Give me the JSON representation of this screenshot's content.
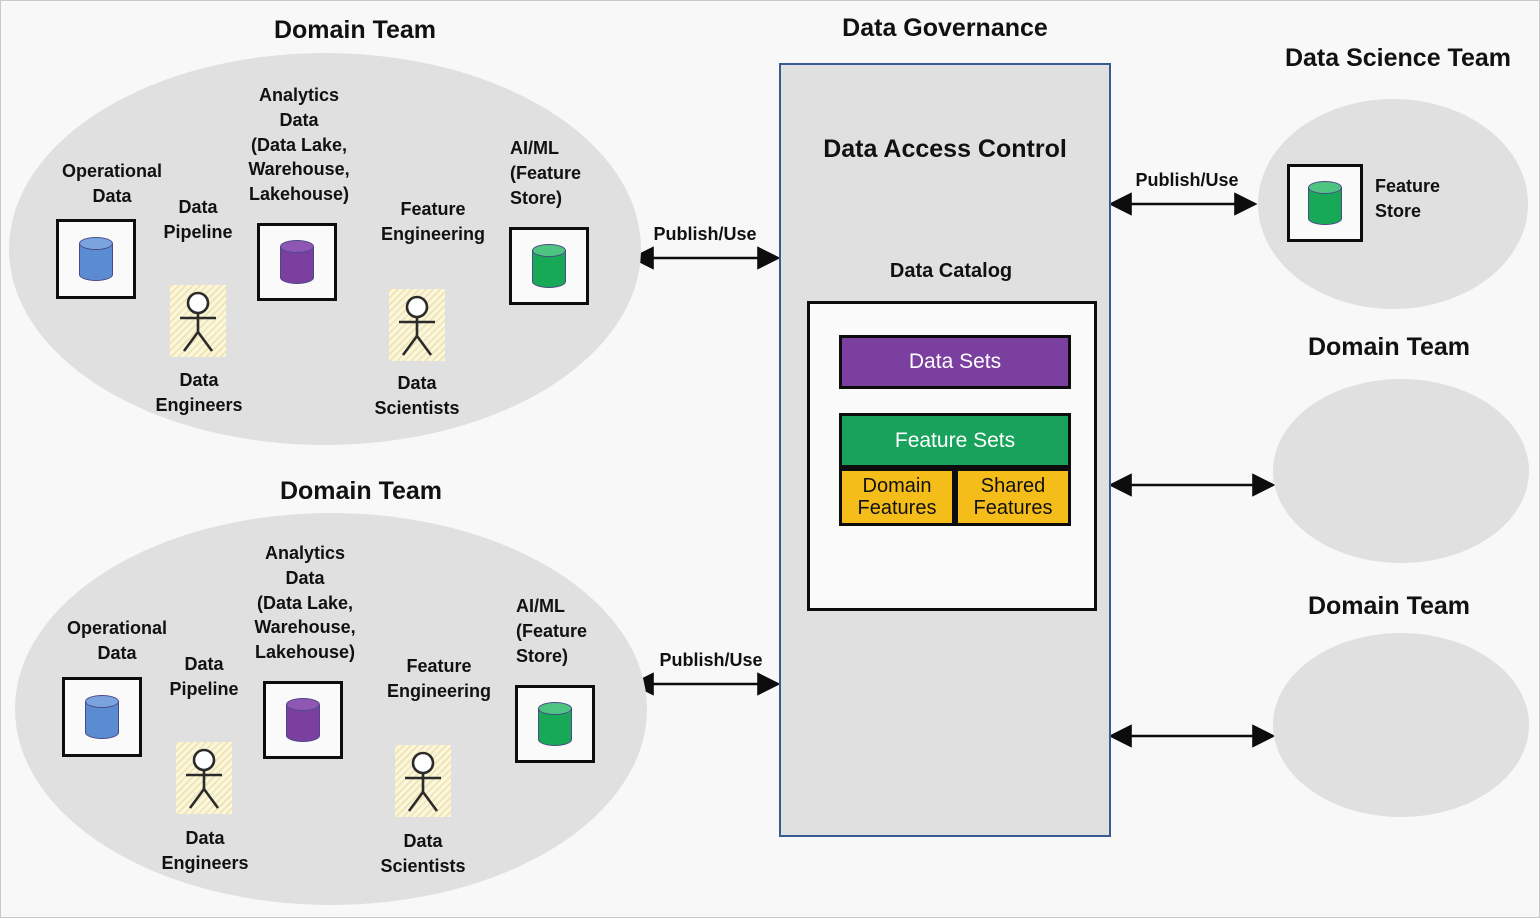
{
  "diagram": {
    "title_top_left": "Domain Team",
    "title_bottom_left": "Domain Team",
    "title_governance": "Data Governance",
    "title_data_science": "Data Science Team",
    "title_domain_right_1": "Domain Team",
    "title_domain_right_2": "Domain Team"
  },
  "colors": {
    "operational_cylinder": "#5b8bd0",
    "operational_cylinder_top": "#7ba3dd",
    "analytics_cylinder": "#7b3fa0",
    "analytics_cylinder_top": "#8f56b3",
    "feature_cylinder": "#18a957",
    "feature_cylinder_top": "#4dc47f",
    "data_sets_chip": "#7b3fa0",
    "feature_sets_chip": "#18a25b",
    "features_chip": "#f5bd1a",
    "panel_border": "#3a5a92",
    "panel_fill": "#e0e0e0",
    "ellipse_fill": "#e0e0e0",
    "person_tile_fill": "#fbf6dc"
  },
  "domain_team_top": {
    "operational_label": "Operational\nData",
    "analytics_label": "Analytics\nData\n(Data Lake,\nWarehouse,\nLakehouse)",
    "aiml_label": "AI/ML\n(Feature\nStore)",
    "arrow_1_label": "Data\nPipeline",
    "arrow_2_label": "Feature\nEngineering",
    "person_1_label": "Data\nEngineers",
    "person_2_label": "Data\nScientists",
    "publish_label": "Publish/Use"
  },
  "domain_team_bottom": {
    "operational_label": "Operational\nData",
    "analytics_label": "Analytics\nData\n(Data Lake,\nWarehouse,\nLakehouse)",
    "aiml_label": "AI/ML\n(Feature\nStore)",
    "arrow_1_label": "Data\nPipeline",
    "arrow_2_label": "Feature\nEngineering",
    "person_1_label": "Data\nEngineers",
    "person_2_label": "Data\nScientists",
    "publish_label": "Publish/Use"
  },
  "governance": {
    "panel_heading": "Data Access Control",
    "catalog_heading": "Data Catalog",
    "chips": {
      "data_sets": "Data Sets",
      "feature_sets": "Feature Sets",
      "domain_features": "Domain\nFeatures",
      "shared_features": "Shared\nFeatures"
    }
  },
  "data_science_team": {
    "feature_store_label": "Feature\nStore",
    "publish_label": "Publish/Use"
  }
}
